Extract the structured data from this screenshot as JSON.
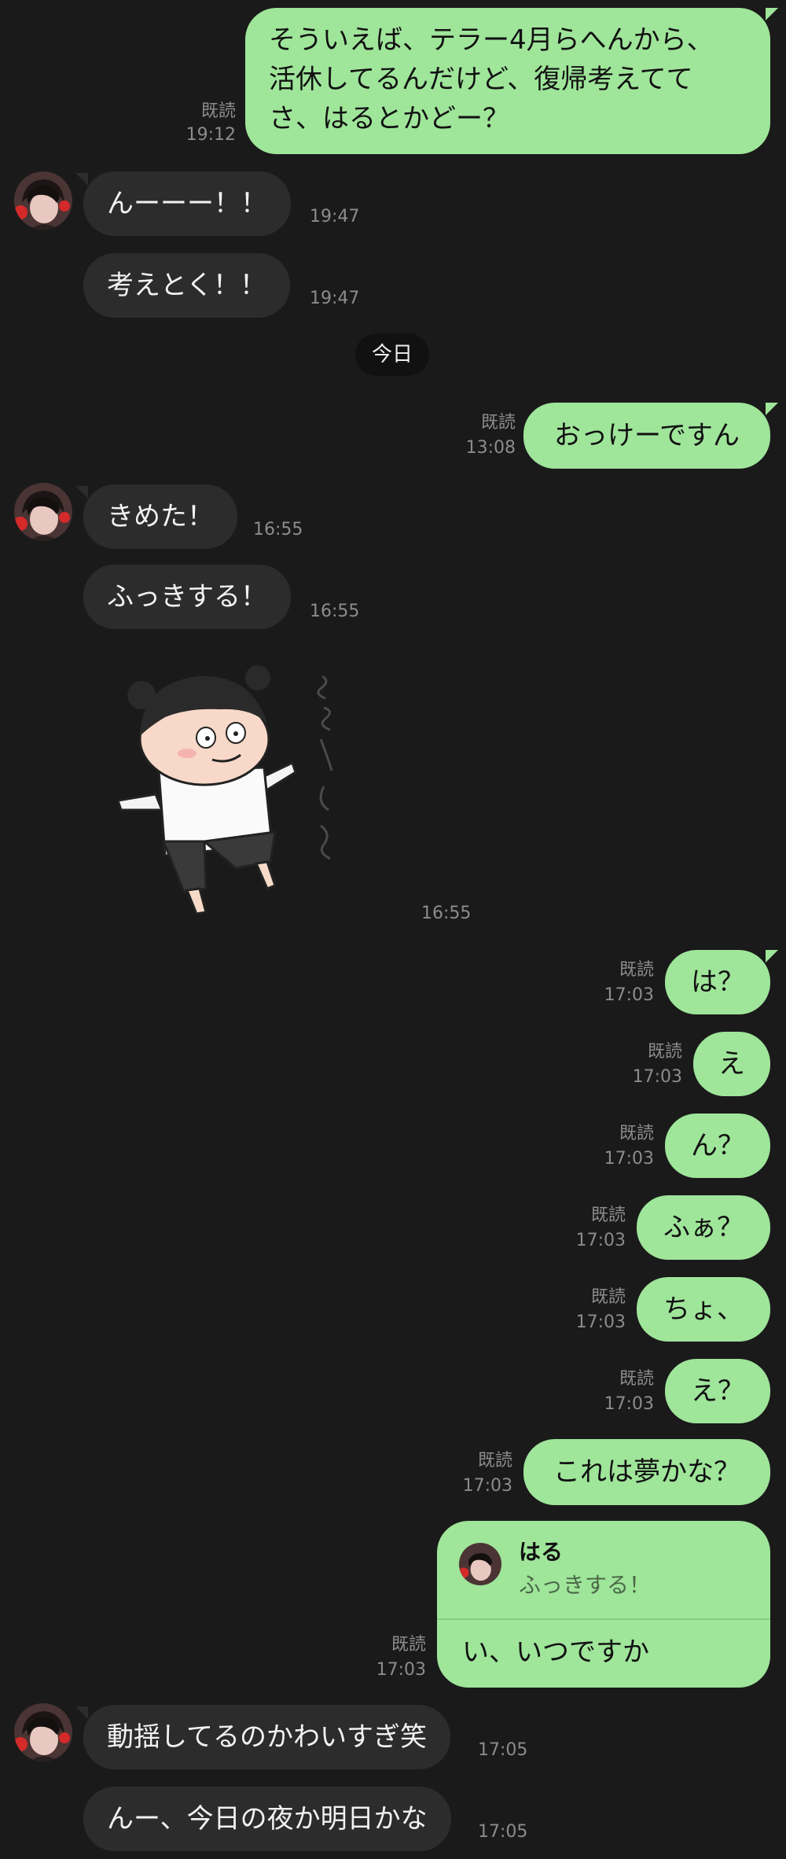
{
  "messages": {
    "m1": {
      "lines": [
        "そういえば、テラー4月らへんから、",
        "活休してるんだけど、復帰考えてて",
        "さ、はるとかどー？"
      ],
      "read": "既読",
      "time": "19:12"
    },
    "m2": {
      "text": "んーーー！！",
      "time": "19:47"
    },
    "m3": {
      "text": "考えとく！！",
      "time": "19:47"
    },
    "date_divider": "今日",
    "m4": {
      "text": "おっけーですん",
      "read": "既読",
      "time": "13:08"
    },
    "m5": {
      "text": "きめた！",
      "time": "16:55"
    },
    "m6": {
      "text": "ふっきする！",
      "time": "16:55"
    },
    "sticker": {
      "time": "16:55"
    },
    "m7": {
      "text": "は？",
      "read": "既読",
      "time": "17:03"
    },
    "m8": {
      "text": "え",
      "read": "既読",
      "time": "17:03"
    },
    "m9": {
      "text": "ん？",
      "read": "既読",
      "time": "17:03"
    },
    "m10": {
      "text": "ふぁ？",
      "read": "既読",
      "time": "17:03"
    },
    "m11": {
      "text": "ちょ、",
      "read": "既読",
      "time": "17:03"
    },
    "m12": {
      "text": "え？",
      "read": "既読",
      "time": "17:03"
    },
    "m13": {
      "text": "これは夢かな？",
      "read": "既読",
      "time": "17:03"
    },
    "m14": {
      "quote_name": "はる",
      "quote_text": "ふっきする！",
      "text": "い、いつですか",
      "read": "既読",
      "time": "17:03"
    },
    "m15": {
      "text": "動揺してるのかわいすぎ笑",
      "time": "17:05"
    },
    "m16": {
      "text": "んー、今日の夜か明日かな",
      "time": "17:05"
    }
  },
  "colors": {
    "background": "#1a1a1a",
    "outgoing": "#9fe59a",
    "incoming": "#2c2c2c"
  }
}
